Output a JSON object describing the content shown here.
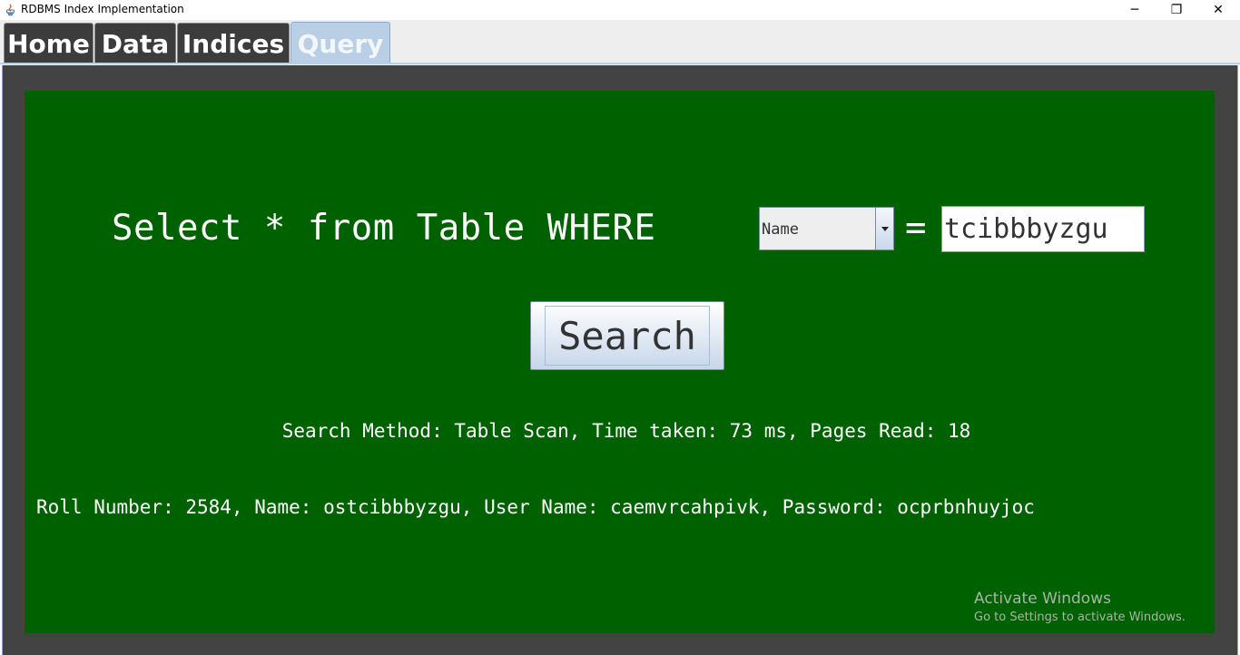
{
  "window": {
    "title": "RDBMS Index Implementation",
    "controls": {
      "minimize": "─",
      "maximize": "❐",
      "close": "✕"
    }
  },
  "tabs": [
    {
      "label": "Home",
      "selected": false
    },
    {
      "label": "Data",
      "selected": false
    },
    {
      "label": "Indices",
      "selected": false
    },
    {
      "label": "Query",
      "selected": true
    }
  ],
  "query": {
    "prefix": "Select * from Table WHERE",
    "column_select": {
      "value": "Name"
    },
    "equals": "=",
    "value_input": {
      "value": "tcibbbyzgu"
    },
    "search_label": "Search"
  },
  "status": "Search Method: Table Scan, Time taken: 73 ms, Pages Read: 18",
  "result": "Roll Number: 2584, Name: ostcibbbyzgu, User Name: caemvrcahpivk, Password: ocprbnhuyjoc",
  "watermark": {
    "title": "Activate Windows",
    "subtitle": "Go to Settings to activate Windows."
  },
  "colors": {
    "panel_bg": "#006100",
    "frame_bg": "#434343",
    "tab_bg": "#3c3c3c",
    "tab_selected_bg": "#b8cfe5"
  }
}
